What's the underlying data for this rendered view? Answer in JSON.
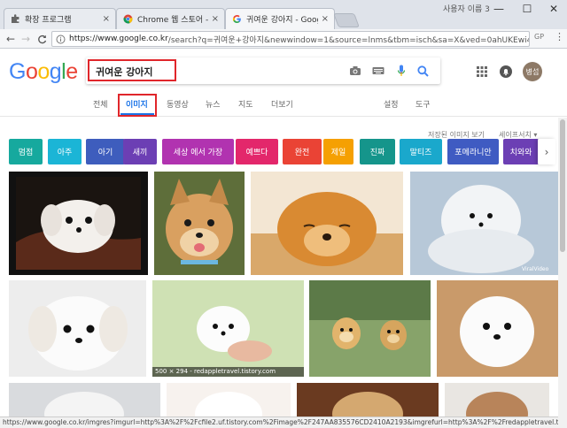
{
  "browser": {
    "tabs": [
      {
        "label": "확장 프로그램",
        "close": "×"
      },
      {
        "label": "Chrome 웹 스토어 - Go",
        "close": "×"
      },
      {
        "label": "귀여운 강아지 - Google",
        "close": "×"
      }
    ],
    "user_name": "사용자 이름 3",
    "window_controls": {
      "minimize": "—",
      "maximize": "☐",
      "close": "✕"
    },
    "nav": {
      "back": "←",
      "forward": "→",
      "reload": "C"
    },
    "url_host": "https://www.google.co.kr",
    "url_rest": "/search?q=귀여운+강아지&newwindow=1&source=lnms&tbm=isch&sa=X&ved=0ahUKEwi4rpTF...",
    "extensions": [
      "GP",
      "⋮"
    ]
  },
  "google": {
    "logo_letters": [
      {
        "ch": "G",
        "color": "#4285F4"
      },
      {
        "ch": "o",
        "color": "#EA4335"
      },
      {
        "ch": "o",
        "color": "#FBBC05"
      },
      {
        "ch": "g",
        "color": "#4285F4"
      },
      {
        "ch": "l",
        "color": "#34A853"
      },
      {
        "ch": "e",
        "color": "#EA4335"
      }
    ],
    "query": "귀여운 강아지",
    "avatar_text": "병섭",
    "search_tabs": [
      "전체",
      "이미지",
      "동영상",
      "뉴스",
      "지도",
      "더보기"
    ],
    "right_tabs": [
      "설정",
      "도구"
    ],
    "active_tab": "이미지",
    "saved_images": "저장된 이미지 보기",
    "safe_search": "세이프서치 ▾",
    "chips": [
      {
        "label": "멈점",
        "color": "#16a99e"
      },
      {
        "label": "아주",
        "color": "#1bb5d6"
      },
      {
        "label": "아기",
        "color": "#3e5dbd"
      },
      {
        "label": "새끼",
        "color": "#6c3fb4"
      },
      {
        "label": "세상 에서 가장",
        "color": "#b133b0"
      },
      {
        "label": "예쁘다",
        "color": "#e3276b"
      },
      {
        "label": "완전",
        "color": "#ea4335"
      },
      {
        "label": "제일",
        "color": "#f5a002"
      },
      {
        "label": "진짜",
        "color": "#15958b"
      },
      {
        "label": "말티즈",
        "color": "#1aa8cc"
      },
      {
        "label": "포메라니안",
        "color": "#3f5bc2"
      },
      {
        "label": "치와와",
        "color": "#6c3fb4"
      }
    ],
    "chip_next": "›",
    "image_caption": "500 × 294 - redappletravel.tistory.com",
    "video_watermark": "ViralVideo"
  },
  "status_url": "https://www.google.co.kr/imgres?imgurl=http%3A%2F%2Fcfile2.uf.tistory.com%2Fimage%2F247AA835576CD2410A2193&imgrefurl=http%3A%2F%2Fredappletravel.tistory.com%2..."
}
